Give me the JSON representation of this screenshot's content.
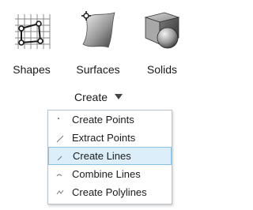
{
  "tools": [
    {
      "label": "Shapes",
      "icon": "shapes-grid-icon"
    },
    {
      "label": "Surfaces",
      "icon": "surface-patch-icon"
    },
    {
      "label": "Solids",
      "icon": "solids-icon"
    }
  ],
  "group": {
    "label": "Create",
    "icon": "caret-down-icon"
  },
  "menu": {
    "items": [
      {
        "label": "Create Points",
        "icon": "point-icon"
      },
      {
        "label": "Extract Points",
        "icon": "extract-points-icon"
      },
      {
        "label": "Create Lines",
        "icon": "line-icon",
        "highlighted": true
      },
      {
        "label": "Combine Lines",
        "icon": "combine-lines-icon"
      },
      {
        "label": "Create Polylines",
        "icon": "polyline-icon"
      }
    ]
  },
  "colors": {
    "highlight_fill": "#dbeefa",
    "highlight_border": "#88c1e6",
    "menu_border": "#b9c2cc",
    "text": "#1a1a1a"
  }
}
